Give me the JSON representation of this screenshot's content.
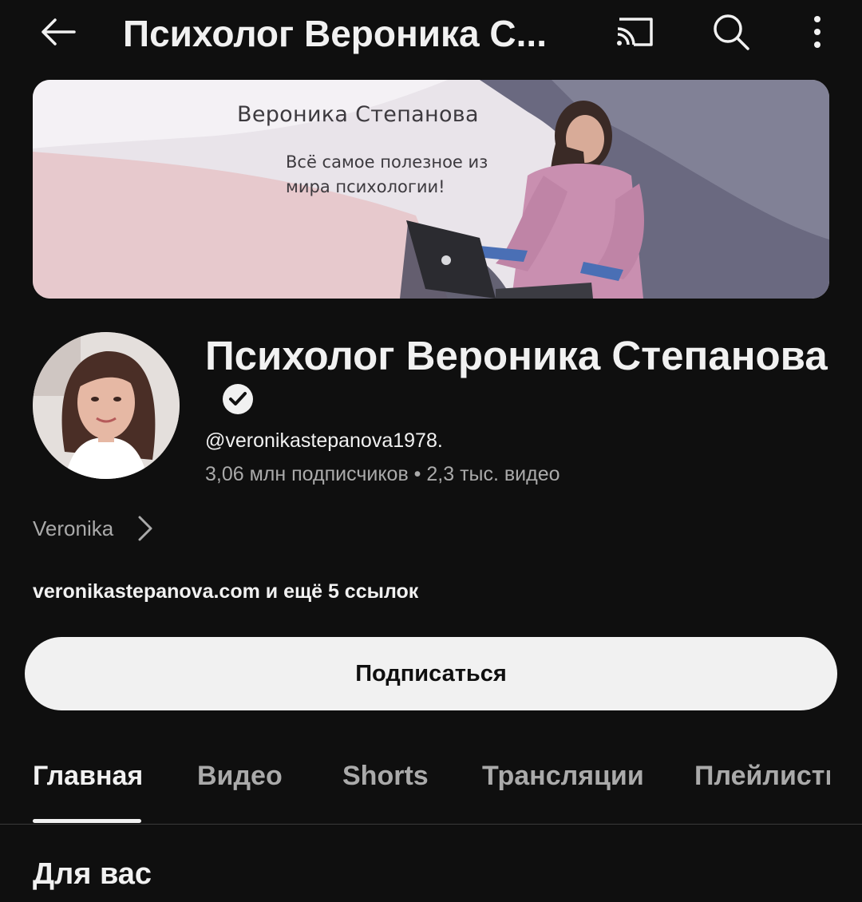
{
  "topbar": {
    "title": "Психолог Вероника С...",
    "icons": [
      "back-arrow-icon",
      "cast-icon",
      "search-icon",
      "more-vert-icon"
    ]
  },
  "banner": {
    "name": "Вероника Степанова",
    "tagline": "Всё самое полезное из мира психологии!"
  },
  "channel": {
    "name": "Психолог Вероника Степанова",
    "handle": "@veronikastepanova1978.",
    "stats": "3,06 млн подписчиков • 2,3 тыс. видео",
    "description": "Veronika",
    "links": "veronikastepanova.com и ещё 5 ссылок"
  },
  "subscribe": {
    "label": "Подписаться"
  },
  "tabs": [
    {
      "label": "Главная",
      "active": true
    },
    {
      "label": "Видео",
      "active": false
    },
    {
      "label": "Shorts",
      "active": false
    },
    {
      "label": "Трансляции",
      "active": false
    },
    {
      "label": "Плейлисты",
      "active": false
    }
  ],
  "section": {
    "title": "Для вас"
  },
  "colors": {
    "background": "#0f0f0f",
    "text_primary": "#f1f1f1",
    "text_secondary": "#aaaaaa",
    "button_bg": "#f1f1f1"
  }
}
